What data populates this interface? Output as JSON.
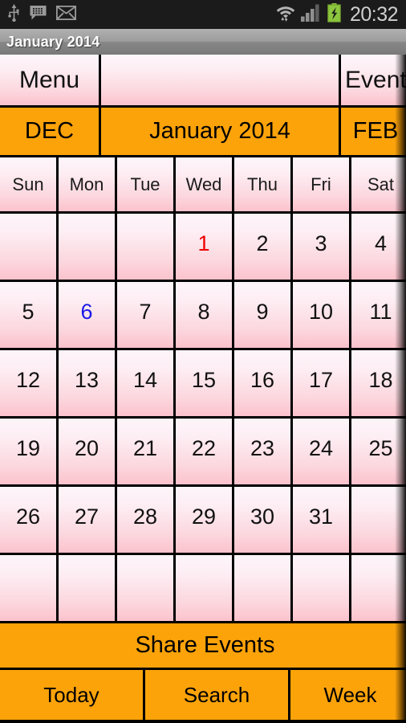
{
  "status_bar": {
    "icons_left": [
      "usb-icon",
      "messaging-icon",
      "email-icon"
    ],
    "icons_right": [
      "wifi-icon",
      "signal-icon",
      "battery-charging-icon"
    ],
    "time": "20:32",
    "background": "#1b1b1b",
    "battery_color": "#8cc63e"
  },
  "title_bar": {
    "title": "January 2014"
  },
  "toolbar": {
    "menu_label": "Menu",
    "spacer_label": "",
    "event_label": "Event"
  },
  "month_nav": {
    "prev_label": "DEC",
    "current_label": "January 2014",
    "next_label": "FEB",
    "background": "#FCA30A"
  },
  "calendar": {
    "weekdays": [
      "Sun",
      "Mon",
      "Tue",
      "Wed",
      "Thu",
      "Fri",
      "Sat"
    ],
    "weeks": [
      [
        {
          "day": "",
          "color": "default"
        },
        {
          "day": "",
          "color": "default"
        },
        {
          "day": "",
          "color": "default"
        },
        {
          "day": "1",
          "color": "red"
        },
        {
          "day": "2",
          "color": "default"
        },
        {
          "day": "3",
          "color": "default"
        },
        {
          "day": "4",
          "color": "default"
        }
      ],
      [
        {
          "day": "5",
          "color": "default"
        },
        {
          "day": "6",
          "color": "blue"
        },
        {
          "day": "7",
          "color": "default"
        },
        {
          "day": "8",
          "color": "default"
        },
        {
          "day": "9",
          "color": "default"
        },
        {
          "day": "10",
          "color": "default"
        },
        {
          "day": "11",
          "color": "default"
        }
      ],
      [
        {
          "day": "12",
          "color": "default"
        },
        {
          "day": "13",
          "color": "default"
        },
        {
          "day": "14",
          "color": "default"
        },
        {
          "day": "15",
          "color": "default"
        },
        {
          "day": "16",
          "color": "default"
        },
        {
          "day": "17",
          "color": "default"
        },
        {
          "day": "18",
          "color": "default"
        }
      ],
      [
        {
          "day": "19",
          "color": "default"
        },
        {
          "day": "20",
          "color": "default"
        },
        {
          "day": "21",
          "color": "default"
        },
        {
          "day": "22",
          "color": "default"
        },
        {
          "day": "23",
          "color": "default"
        },
        {
          "day": "24",
          "color": "default"
        },
        {
          "day": "25",
          "color": "default"
        }
      ],
      [
        {
          "day": "26",
          "color": "default"
        },
        {
          "day": "27",
          "color": "default"
        },
        {
          "day": "28",
          "color": "default"
        },
        {
          "day": "29",
          "color": "default"
        },
        {
          "day": "30",
          "color": "default"
        },
        {
          "day": "31",
          "color": "default"
        },
        {
          "day": "",
          "color": "default"
        }
      ],
      [
        {
          "day": "",
          "color": "default"
        },
        {
          "day": "",
          "color": "default"
        },
        {
          "day": "",
          "color": "default"
        },
        {
          "day": "",
          "color": "default"
        },
        {
          "day": "",
          "color": "default"
        },
        {
          "day": "",
          "color": "default"
        },
        {
          "day": "",
          "color": "default"
        }
      ]
    ],
    "holiday_color": "#f00000",
    "selected_color": "#1818e8",
    "default_color": "#111111"
  },
  "share_bar": {
    "label": "Share Events"
  },
  "bottom_bar": {
    "buttons": [
      {
        "label": "Today"
      },
      {
        "label": "Search"
      },
      {
        "label": "Week"
      }
    ]
  }
}
